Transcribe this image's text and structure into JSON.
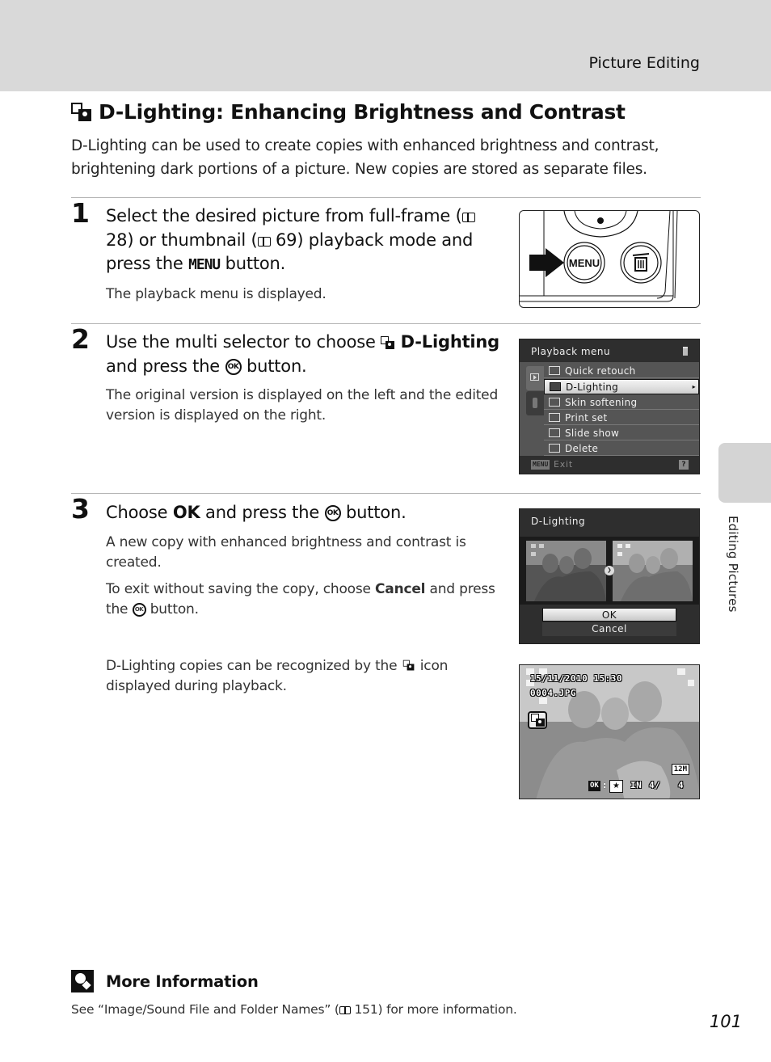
{
  "header": {
    "section": "Picture Editing"
  },
  "title": {
    "text": "D-Lighting: Enhancing Brightness and Contrast",
    "icon": "d-lighting-icon"
  },
  "intro": "D-Lighting can be used to create copies with enhanced brightness and contrast, brightening dark portions of a picture. New copies are stored as separate files.",
  "steps": [
    {
      "number": "1",
      "head": {
        "part1": "Select the desired picture from full-frame (",
        "ref1": "28",
        "part2": ") or thumbnail (",
        "ref2": "69",
        "part3": ") playback mode and press the ",
        "button": "MENU",
        "part4": " button."
      },
      "body": [
        "The playback menu is displayed."
      ]
    },
    {
      "number": "2",
      "head": {
        "part1": "Use the multi selector to choose ",
        "bold": "D-Lighting",
        "part2": " and press the ",
        "button": "OK",
        "part3": " button."
      },
      "body": [
        "The original version is displayed on the left and the edited version is displayed on the right."
      ]
    },
    {
      "number": "3",
      "head": {
        "part1": "Choose ",
        "bold": "OK",
        "part2": " and press the ",
        "button": "OK",
        "part3": " button."
      },
      "body": [
        "A new copy with enhanced brightness and contrast is created.",
        {
          "part1": "To exit without saving the copy, choose ",
          "bold": "Cancel",
          "part2": " and press the ",
          "button": "OK",
          "part3": " button."
        }
      ],
      "note": {
        "part1": "D-Lighting copies can be recognized by the ",
        "part2": " icon displayed during playback."
      }
    }
  ],
  "figures": {
    "camera": {
      "menu_button_label": "MENU",
      "delete_icon": "trash-icon",
      "arrow": "arrow-right-icon"
    },
    "playback_menu": {
      "title": "Playback menu",
      "items": [
        {
          "label": "Quick retouch",
          "icon": "quick-retouch-icon",
          "selected": false
        },
        {
          "label": "D-Lighting",
          "icon": "d-lighting-icon",
          "selected": true
        },
        {
          "label": "Skin softening",
          "icon": "skin-softening-icon",
          "selected": false
        },
        {
          "label": "Print set",
          "icon": "print-icon",
          "selected": false
        },
        {
          "label": "Slide show",
          "icon": "slide-show-icon",
          "selected": false
        },
        {
          "label": "Delete",
          "icon": "trash-icon",
          "selected": false
        }
      ],
      "footer_button": "MENU",
      "footer_label": "Exit",
      "help": "?"
    },
    "d_lighting_screen": {
      "title": "D-Lighting",
      "options": [
        "OK",
        "Cancel"
      ],
      "selected": "OK"
    },
    "playback_screen": {
      "date": "15/11/2010 15:30",
      "file": "0004.JPG",
      "image_size": "12M",
      "ok_label": "OK",
      "separator": ":",
      "memory": "IN",
      "frame": "4/",
      "total": "4"
    }
  },
  "side_tab": {
    "label": "Editing Pictures"
  },
  "more_info": {
    "title": "More Information",
    "body_part1": "See “Image/Sound File and Folder Names” (",
    "ref": "151",
    "body_part2": ") for more information."
  },
  "page_number": "101",
  "colors": {
    "header_band": "#d9d9d9",
    "side_tab": "#d4d4d4",
    "lcd_bg": "#2e2e2e",
    "lcd_panel": "#555555"
  }
}
